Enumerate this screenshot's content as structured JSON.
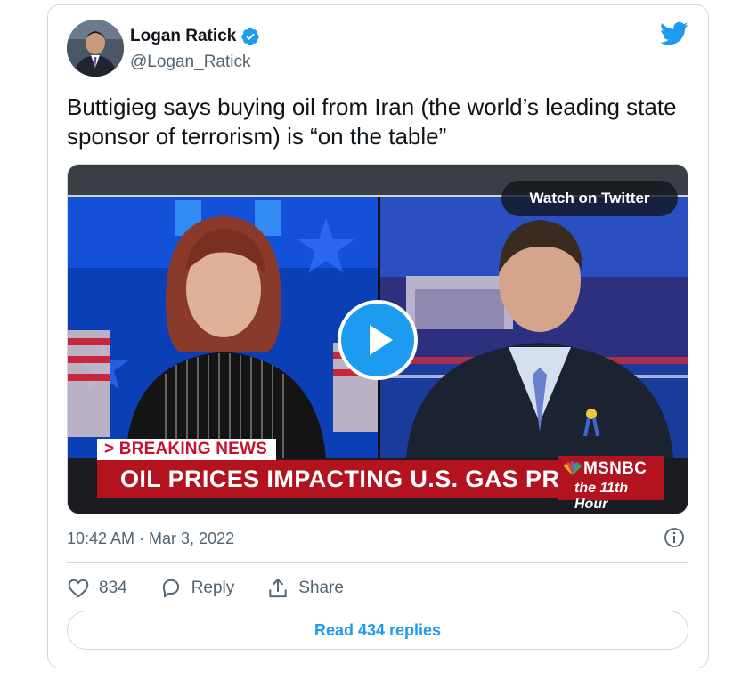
{
  "author": {
    "name": "Logan Ratick",
    "handle": "@Logan_Ratick"
  },
  "tweet": {
    "text": "Buttigieg says buying oil from Iran (the world’s leading state sponsor of terrorism) is “on the table”",
    "timestamp": "10:42 AM · Mar 3, 2022"
  },
  "media": {
    "watch_label": "Watch on Twitter",
    "breaking_label": "> BREAKING NEWS",
    "banner_text": "OIL PRICES IMPACTING U.S. GAS PRICES",
    "network": "MSNBC",
    "show": "the 11th Hour"
  },
  "actions": {
    "like_count": "834",
    "reply_label": "Reply",
    "share_label": "Share"
  },
  "read_replies_label": "Read 434 replies",
  "colors": {
    "accent": "#1d9bf0",
    "muted_text": "#536471",
    "border": "#cfd9de",
    "banner_red": "#b3121f"
  },
  "icons": [
    "verified-badge-icon",
    "twitter-bird-icon",
    "play-icon",
    "info-icon",
    "heart-icon",
    "reply-icon",
    "share-icon"
  ]
}
